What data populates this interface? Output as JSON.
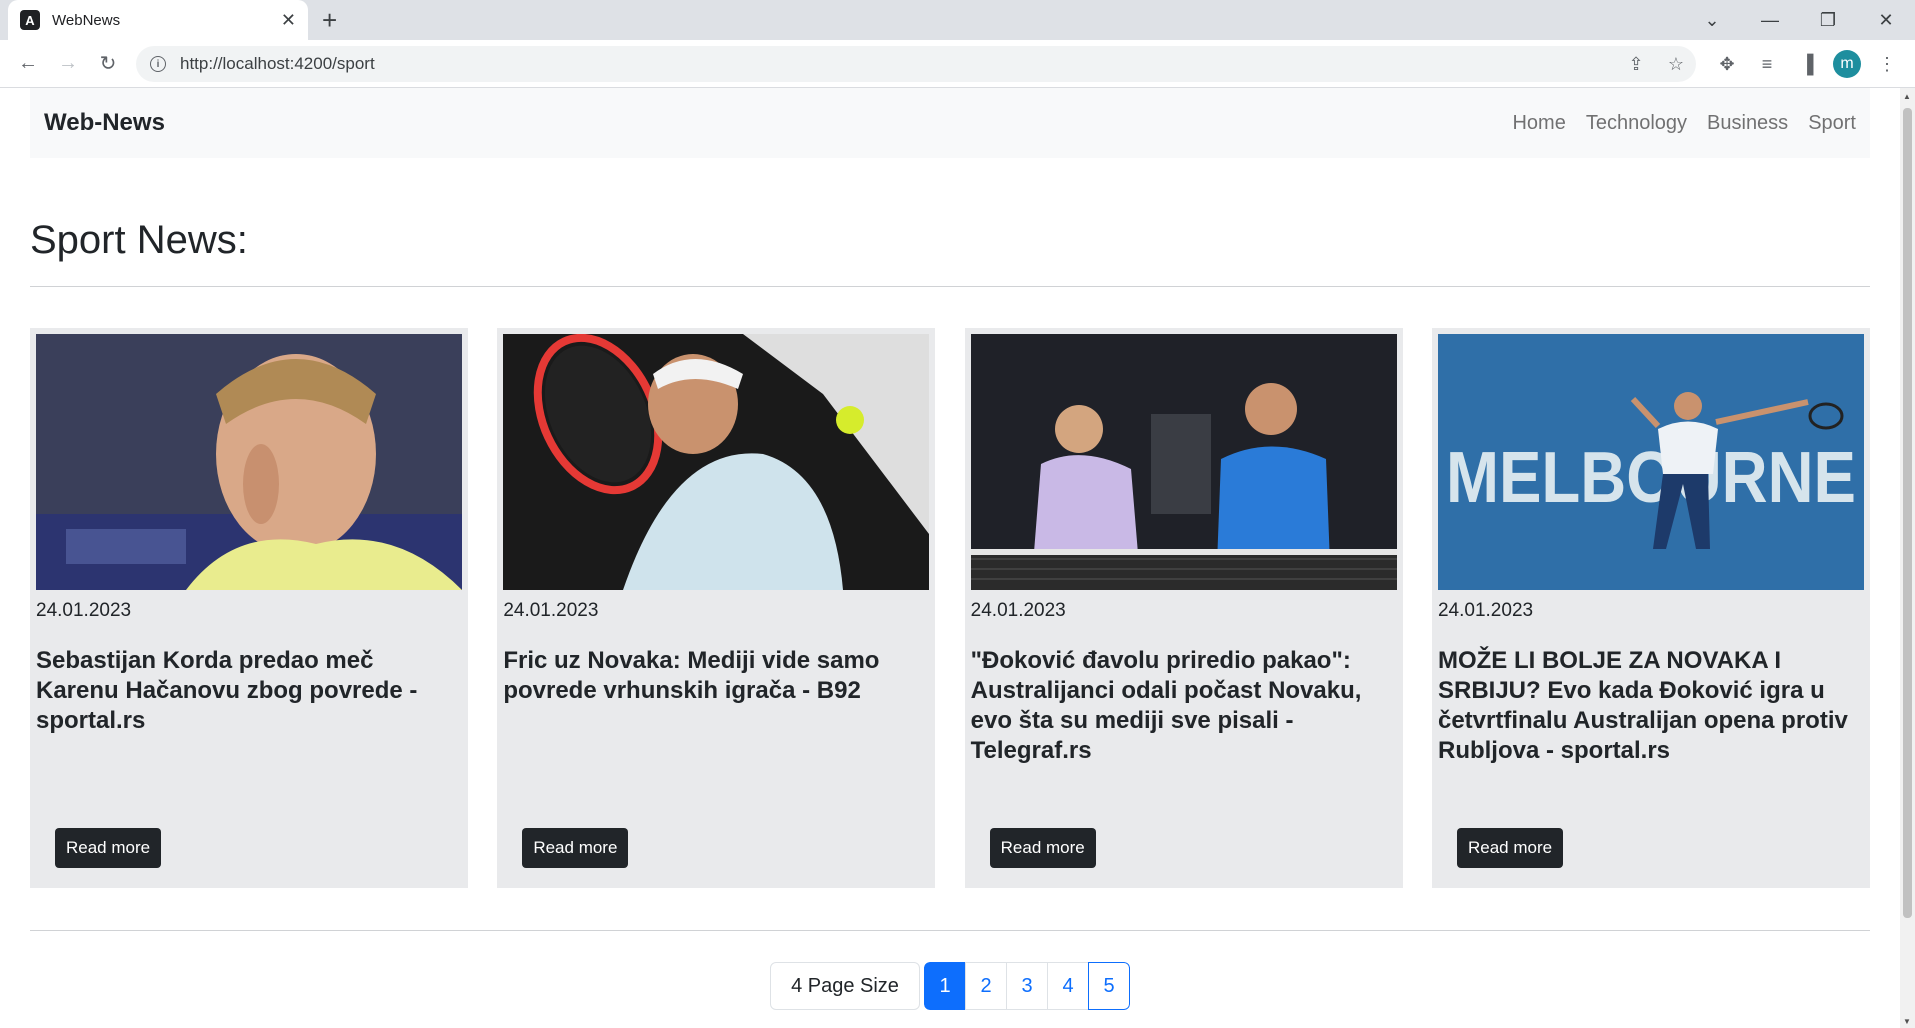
{
  "browser": {
    "tab_title": "WebNews",
    "tab_favicon": "A",
    "url": "http://localhost:4200/sport",
    "avatar_letter": "m"
  },
  "navbar": {
    "brand": "Web-News",
    "links": [
      "Home",
      "Technology",
      "Business",
      "Sport"
    ]
  },
  "page": {
    "title": "Sport News:"
  },
  "articles": [
    {
      "date": "24.01.2023",
      "title": "Sebastijan Korda predao meč Karenu Hačanovu zbog povrede - sportal.rs",
      "button": "Read more"
    },
    {
      "date": "24.01.2023",
      "title": "Fric uz Novaka: Mediji vide samo povrede vrhunskih igrača - B92",
      "button": "Read more"
    },
    {
      "date": "24.01.2023",
      "title": "\"Đoković đavolu priredio pakao\": Australijanci odali počast Novaku, evo šta su mediji sve pisali - Telegraf.rs",
      "button": "Read more"
    },
    {
      "date": "24.01.2023",
      "title": "MOŽE LI BOLJE ZA NOVAKA I SRBIJU? Evo kada Đoković igra u četvrtfinalu Australijan opena protiv Rubljova - sportal.rs",
      "button": "Read more"
    }
  ],
  "image_text": {
    "melbourne": "MELBOURNE"
  },
  "pagination": {
    "page_size_label": "4 Page Size",
    "pages": [
      "1",
      "2",
      "3",
      "4",
      "5"
    ],
    "active_page": "1"
  }
}
